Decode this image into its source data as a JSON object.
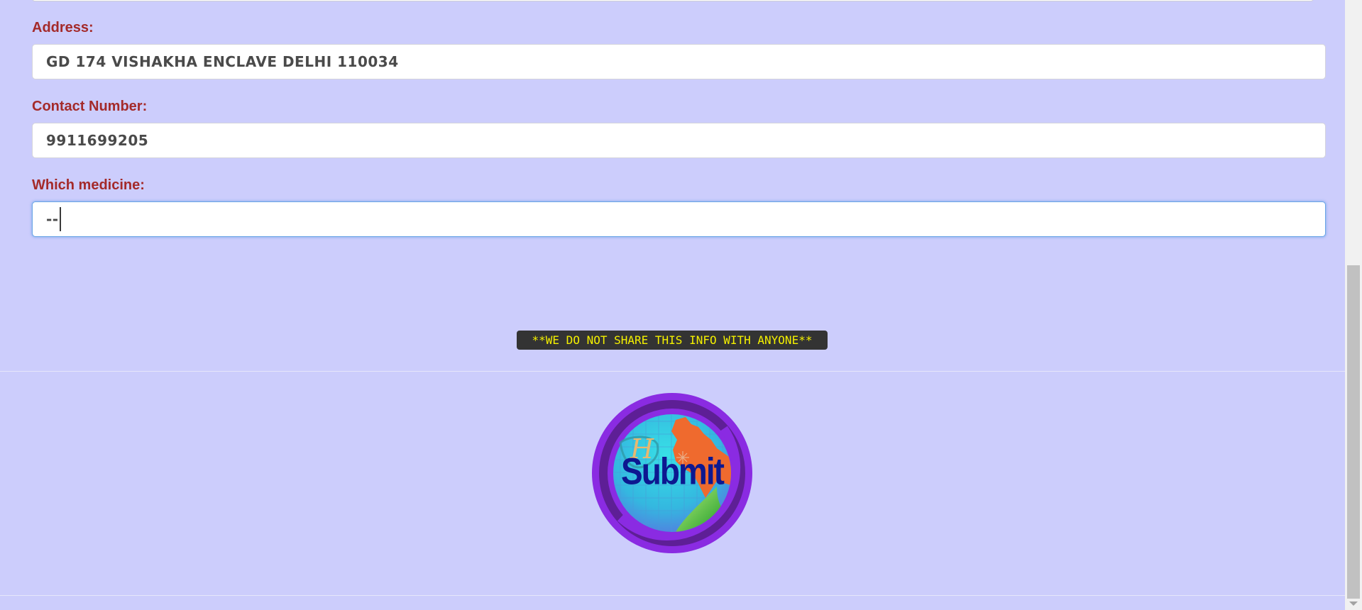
{
  "form": {
    "address_label": "Address:",
    "address_value": "GD 174 VISHAKHA ENCLAVE DELHI 110034",
    "contact_label": "Contact Number:",
    "contact_value": "9911699205",
    "medicine_label": "Which medicine:",
    "medicine_value": "--"
  },
  "notice": {
    "text": "**WE DO NOT SHARE THIS INFO WITH ANYONE**",
    "background_color": "#333333",
    "text_color": "#f4f000"
  },
  "submit": {
    "label": "Submit",
    "logo_letter": "H",
    "logo_icon": "india-map-globe-icon",
    "ring_color": "#8a2be2",
    "globe_color": "#2fd0e0"
  },
  "colors": {
    "page_background": "#cccdfc",
    "label_color": "#a42a2a",
    "focus_border": "#6aa6e6"
  }
}
